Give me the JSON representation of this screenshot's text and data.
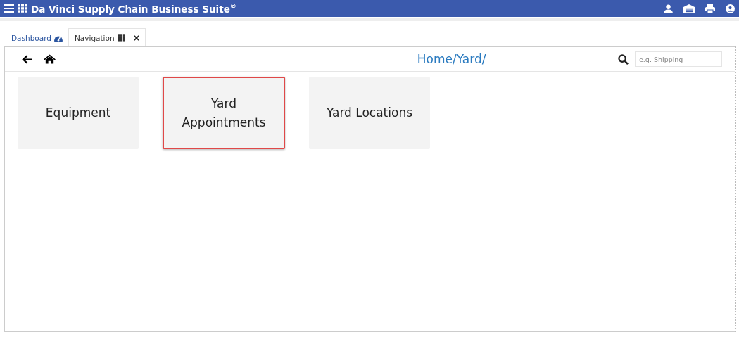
{
  "app_bar": {
    "title": "Da Vinci Supply Chain Business Suite$^{©}$"
  },
  "tabs": [
    {
      "label": "Dashboard",
      "kind": "gauge",
      "selected": false,
      "closable": false
    },
    {
      "label": "Navigation",
      "kind": "grid",
      "selected": true,
      "closable": true
    }
  ],
  "toolbar": {
    "breadcrumb": "Home/Yard/",
    "search": {
      "placeholder": "e.g. Shipping"
    }
  },
  "tiles": [
    {
      "label": "Equipment",
      "selected": false
    },
    {
      "label": "Yard Appointments",
      "selected": true
    },
    {
      "label": "Yard Locations",
      "selected": false
    }
  ]
}
